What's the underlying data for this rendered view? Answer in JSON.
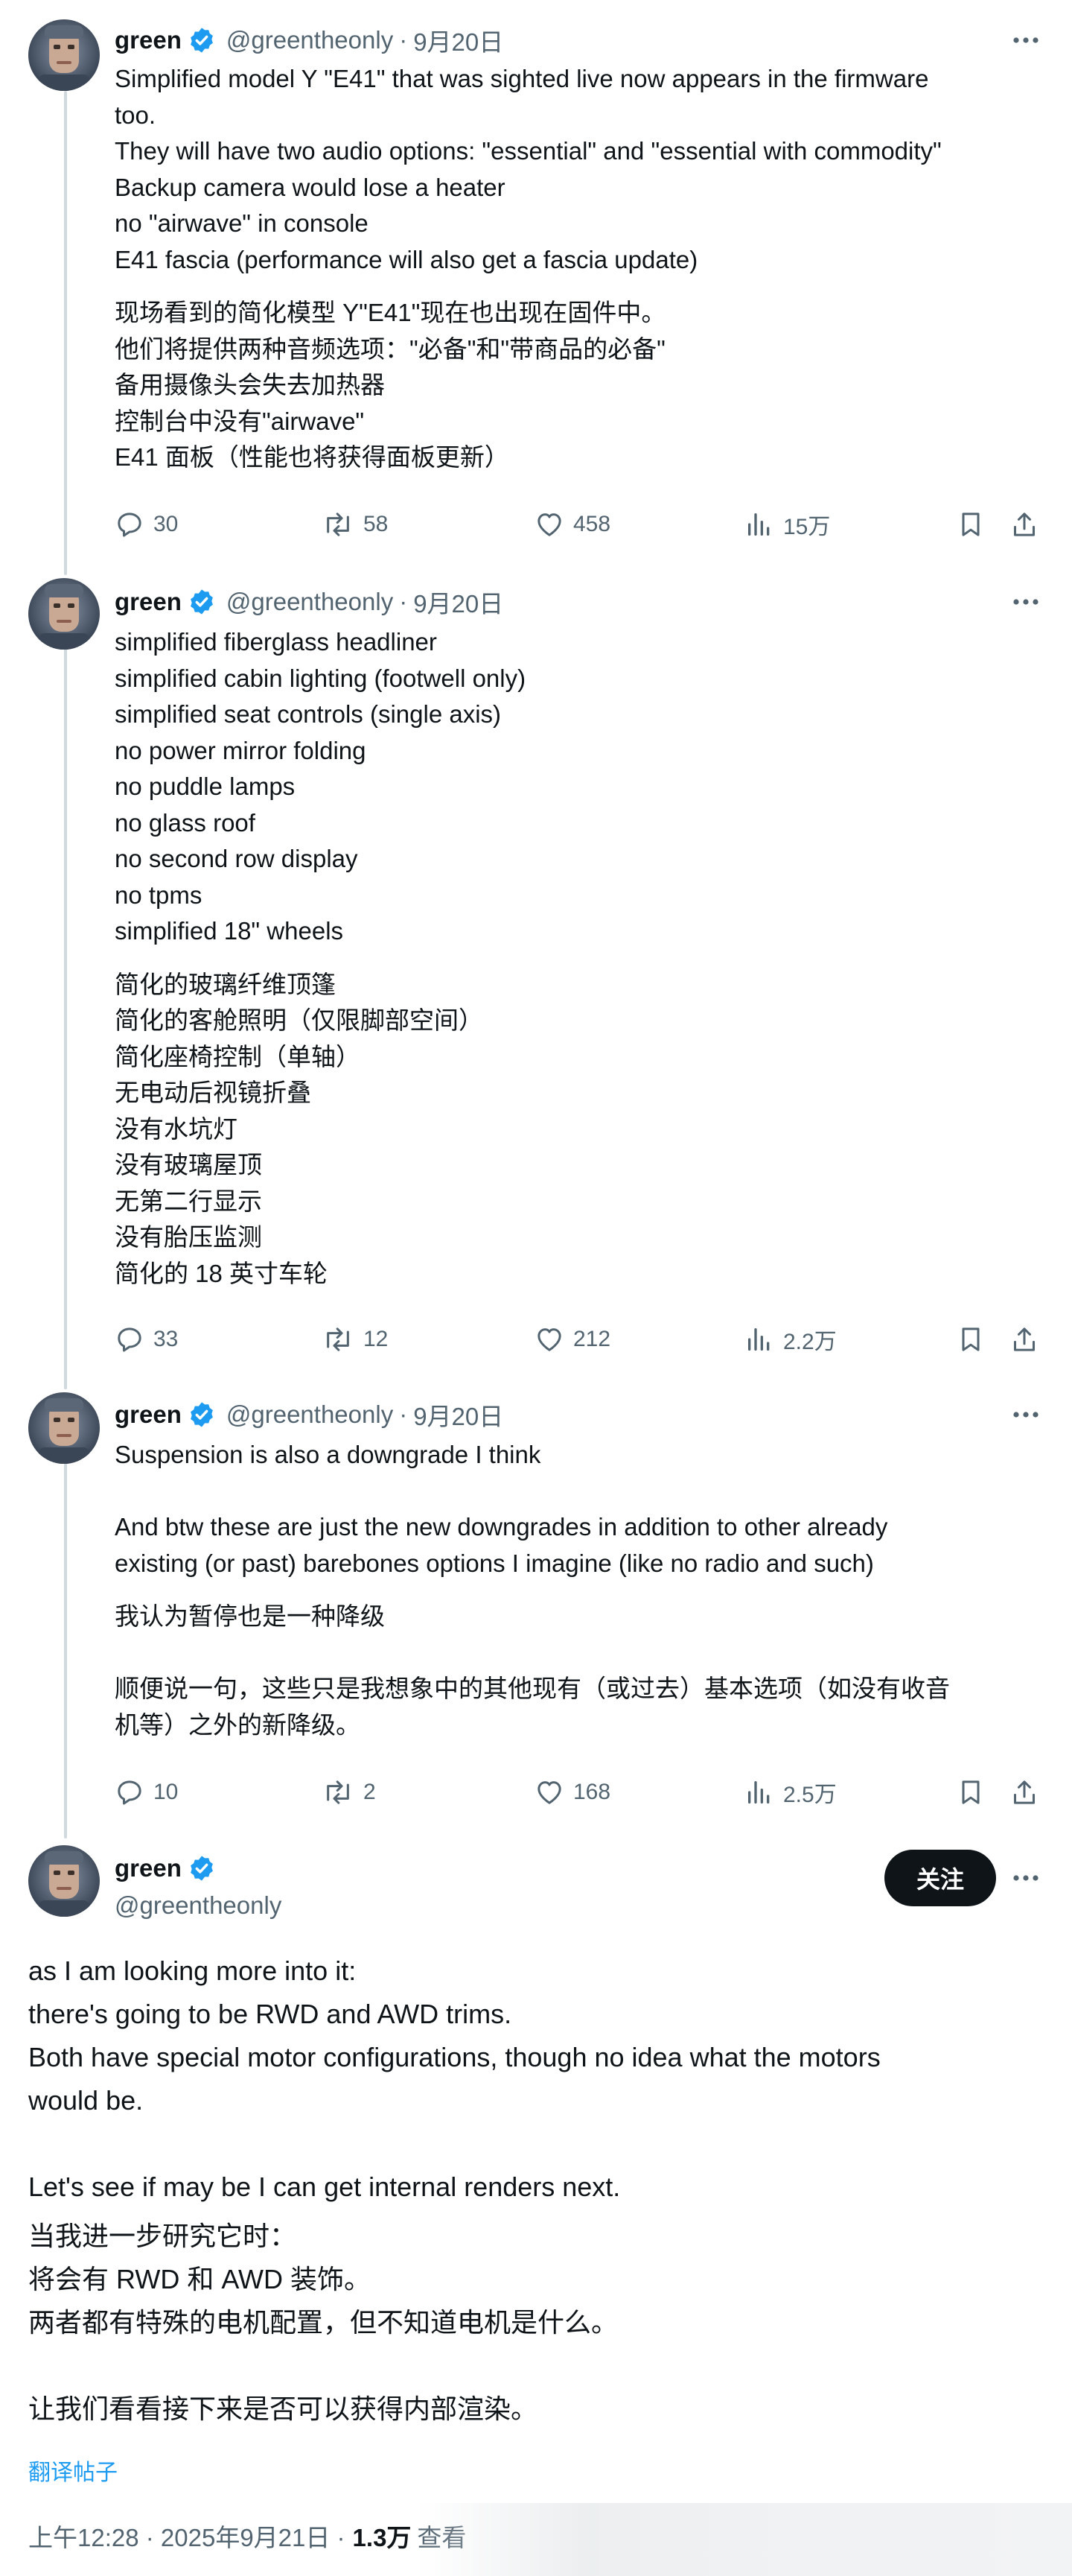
{
  "colors": {
    "text": "#0f1419",
    "secondary": "#536471",
    "accent": "#1d9bf0",
    "thread_line": "#cfd9de"
  },
  "tweets": [
    {
      "author": {
        "name": "green",
        "handle": "@greentheonly",
        "verified": true
      },
      "sep": "·",
      "date": "9月20日",
      "en": [
        "Simplified model Y \"E41\" that was sighted live now appears in the firmware",
        "too.",
        "They will have two audio options: \"essential\" and \"essential with commodity\"",
        "Backup camera would lose a heater",
        "no \"airwave\" in console",
        "E41 fascia (performance will also get a fascia update)"
      ],
      "zh": [
        "现场看到的简化模型 Y\"E41\"现在也出现在固件中。",
        "他们将提供两种音频选项：\"必备\"和\"带商品的必备\"",
        "备用摄像头会失去加热器",
        "控制台中没有\"airwave\"",
        "E41 面板（性能也将获得面板更新）"
      ],
      "stats": {
        "replies": "30",
        "retweets": "58",
        "likes": "458",
        "views": "15万"
      }
    },
    {
      "author": {
        "name": "green",
        "handle": "@greentheonly",
        "verified": true
      },
      "sep": "·",
      "date": "9月20日",
      "en": [
        "simplified fiberglass headliner",
        "simplified cabin lighting (footwell only)",
        "simplified seat controls (single axis)",
        "no power mirror folding",
        "no puddle lamps",
        "no glass roof",
        "no second row display",
        "no tpms",
        "simplified 18\" wheels"
      ],
      "zh": [
        "简化的玻璃纤维顶篷",
        "简化的客舱照明（仅限脚部空间）",
        "简化座椅控制（单轴）",
        "无电动后视镜折叠",
        "没有水坑灯",
        "没有玻璃屋顶",
        "无第二行显示",
        "没有胎压监测",
        "简化的 18 英寸车轮"
      ],
      "stats": {
        "replies": "33",
        "retweets": "12",
        "likes": "212",
        "views": "2.2万"
      }
    },
    {
      "author": {
        "name": "green",
        "handle": "@greentheonly",
        "verified": true
      },
      "sep": "·",
      "date": "9月20日",
      "en": [
        "Suspension is also a downgrade I think",
        "",
        "And btw these are just the new downgrades in addition to other already",
        "existing (or past) barebones options I imagine (like no radio and such)"
      ],
      "zh": [
        "我认为暂停也是一种降级",
        "",
        "顺便说一句，这些只是我想象中的其他现有（或过去）基本选项（如没有收音",
        "机等）之外的新降级。"
      ],
      "stats": {
        "replies": "10",
        "retweets": "2",
        "likes": "168",
        "views": "2.5万"
      }
    }
  ],
  "main_tweet": {
    "author": {
      "name": "green",
      "handle": "@greentheonly",
      "verified": true
    },
    "follow_label": "关注",
    "en": [
      "as I am looking more into it:",
      "there's going to be RWD and AWD trims.",
      "Both have special motor configurations, though no idea what the motors",
      "would be.",
      "",
      "Let's see if may be I can get internal renders next."
    ],
    "zh": [
      "当我进一步研究它时：",
      "将会有 RWD 和 AWD 装饰。",
      "两者都有特殊的电机配置，但不知道电机是什么。",
      "",
      "让我们看看接下来是否可以获得内部渲染。"
    ],
    "translate_label": "翻译帖子",
    "timestamp": "上午12:28 · 2025年9月21日 ·",
    "views_count": "1.3万",
    "views_label": "查看"
  },
  "icons": [
    "more-icon",
    "verified-icon",
    "reply-icon",
    "retweet-icon",
    "like-icon",
    "views-icon",
    "bookmark-icon",
    "share-icon"
  ]
}
